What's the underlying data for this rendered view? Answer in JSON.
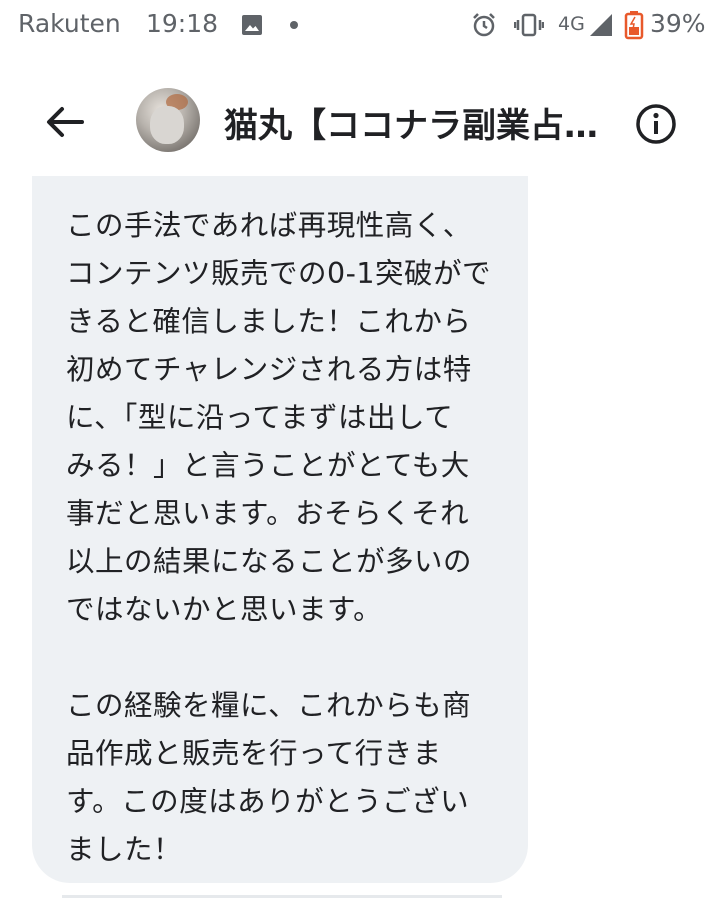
{
  "status_bar": {
    "carrier": "Rakuten",
    "time": "19:18",
    "network": "4G",
    "battery_percent": "39%",
    "icons": [
      "gallery-icon",
      "dot-icon",
      "alarm-icon",
      "vibrate-icon",
      "signal-icon",
      "battery-icon"
    ],
    "battery_color": "#e8592b"
  },
  "header": {
    "contact_name": "猫丸【ココナラ副業占い…",
    "back_icon": "arrow-left-icon",
    "info_icon": "info-icon"
  },
  "message": {
    "text": "この手法であれば再現性高く、\nコンテンツ販売での0-1突破がで\nきると確信しました！これから\n初めてチャレンジされる方は特\nに、「型に沿ってまずは出して\nみる！」と言うことがとても大\n事だと思います。おそらくそれ\n以上の結果になることが多いの\nではないかと思います。\n\nこの経験を糧に、これからも商\n品作成と販売を行って行きま\nす。この度はありがとうござい\nました！"
  },
  "colors": {
    "bubble_background": "#eef1f4",
    "status_text": "#5f6368",
    "primary_text": "#202124"
  }
}
